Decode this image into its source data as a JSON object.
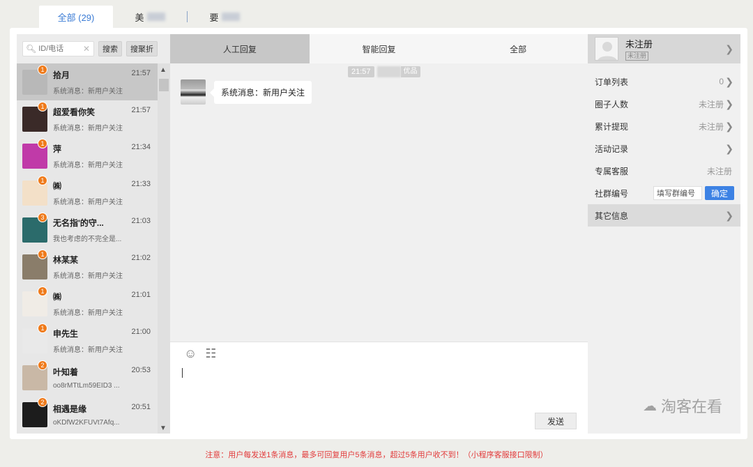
{
  "top_tabs": [
    {
      "label": "全部 (29)",
      "active": true
    },
    {
      "label": "美",
      "blurred": true
    },
    {
      "label": "要",
      "blurred": true
    }
  ],
  "search": {
    "placeholder": "ID/电话",
    "search_label": "搜索",
    "collapse_label": "搜聚折"
  },
  "conversations": [
    {
      "name": "拾月",
      "time": "21:57",
      "badge": "1",
      "message": "系统消息：新用户关注",
      "color": "#b8b8b8",
      "active": true
    },
    {
      "name": "超爱看你笑",
      "time": "21:57",
      "badge": "1",
      "message": "系统消息：新用户关注",
      "color": "#3a2a28"
    },
    {
      "name": "萍",
      "time": "21:34",
      "badge": "1",
      "message": "系统消息：新用户关注",
      "color": "#c03aa8"
    },
    {
      "name": "㈱",
      "time": "21:33",
      "badge": "1",
      "message": "系统消息：新用户关注",
      "color": "#f3e0c8"
    },
    {
      "name": "无名指'的守...",
      "time": "21:03",
      "badge": "3",
      "message": "我也考虑的不完全是...",
      "color": "#2b6b6b"
    },
    {
      "name": "林某某",
      "time": "21:02",
      "badge": "1",
      "message": "系统消息：新用户关注",
      "color": "#8a7d6a"
    },
    {
      "name": "㈱",
      "time": "21:01",
      "badge": "1",
      "message": "系统消息：新用户关注",
      "color": "#f0ece6"
    },
    {
      "name": "申先生",
      "time": "21:00",
      "badge": "1",
      "message": "系统消息：新用户关注",
      "color": "#e9e9e9"
    },
    {
      "name": "叶知着",
      "time": "20:53",
      "badge": "2",
      "message": "oo8rMTtLm59EID3 ...",
      "color": "#c9b8a6"
    },
    {
      "name": "相遇是缘",
      "time": "20:51",
      "badge": "2",
      "message": "oKDfW2KFUVt7Afq...",
      "color": "#1c1c1c"
    }
  ],
  "chat_tabs": [
    {
      "label": "人工回复",
      "active": true
    },
    {
      "label": "智能回复"
    },
    {
      "label": "全部"
    }
  ],
  "chat": {
    "timestamp": "21:57",
    "timestamp_suffix": "优品",
    "message": "系统消息：新用户关注",
    "send_label": "发送"
  },
  "profile": {
    "name": "未注册",
    "tag": "未注册"
  },
  "info_rows": [
    {
      "label": "订单列表",
      "value": "0",
      "chevron": true
    },
    {
      "label": "圈子人数",
      "value": "未注册",
      "chevron": true
    },
    {
      "label": "累计提现",
      "value": "未注册",
      "chevron": true
    },
    {
      "label": "活动记录",
      "value": "",
      "chevron": true
    },
    {
      "label": "专属客服",
      "value": "未注册",
      "chevron": false
    }
  ],
  "group": {
    "label": "社群编号",
    "input_value": "填写群编号",
    "confirm_label": "确定"
  },
  "other_info": {
    "label": "其它信息"
  },
  "watermark": "淘客在看",
  "notice": "注意：用户每发送1条消息，最多可回复用户5条消息，超过5条用户收不到！（小程序客服接口限制）",
  "colors": {
    "accent": "#3d82e4",
    "badge": "#ef7a1a",
    "notice": "#e23b3b"
  }
}
